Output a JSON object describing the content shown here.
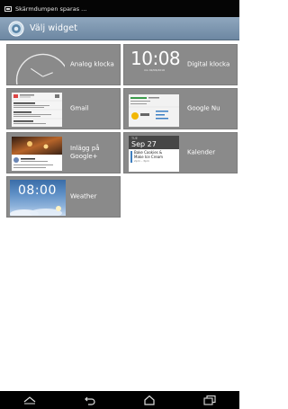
{
  "status_bar": {
    "text": "Skärmdumpen sparas ..."
  },
  "action_bar": {
    "title": "Välj widget"
  },
  "widgets": [
    {
      "label": "Analog klocka"
    },
    {
      "label": "Digital klocka",
      "preview_time": "10:08",
      "preview_sub": "mo 02/06/2016"
    },
    {
      "label": "Gmail"
    },
    {
      "label": "Google Nu"
    },
    {
      "label": "Inlägg på Google+"
    },
    {
      "label": "Kalender",
      "preview_weekday": "TUE",
      "preview_date": "Sep 27",
      "preview_event": "Bake Cookies & Make Ice Cream",
      "preview_event_time": "2pm – 3pm"
    },
    {
      "label": "Weather",
      "preview_time": "08:00"
    }
  ],
  "nav": [
    "collapse-icon",
    "back-icon",
    "home-icon",
    "recents-icon"
  ]
}
